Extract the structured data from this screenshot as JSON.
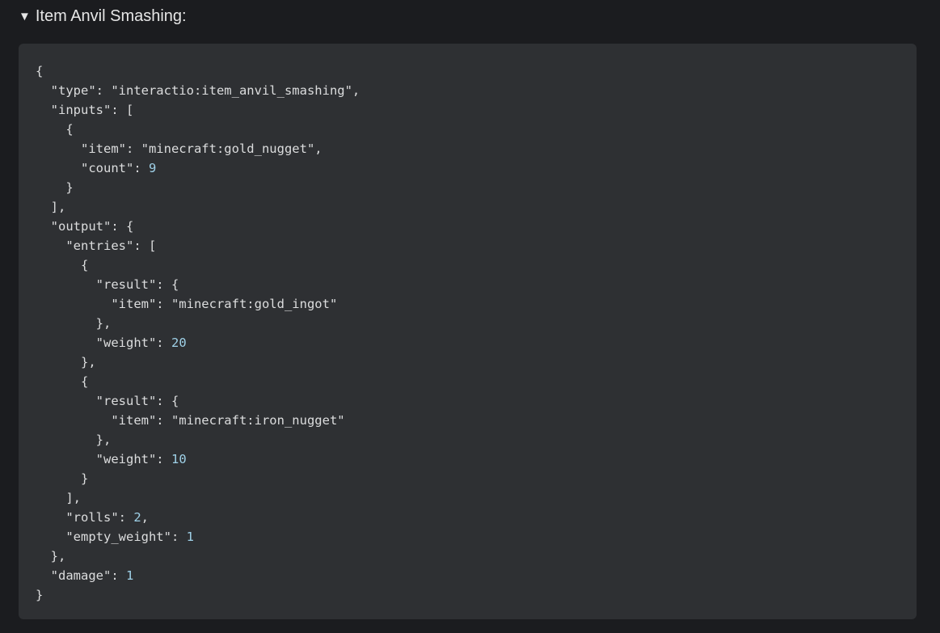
{
  "summary": {
    "triangle": "▼",
    "title": "Item Anvil Smashing:"
  },
  "code": {
    "lines": [
      "{",
      "  \"type\": \"interactio:item_anvil_smashing\",",
      "  \"inputs\": [",
      "    {",
      "      \"item\": \"minecraft:gold_nugget\",",
      "      \"count\": 9",
      "    }",
      "  ],",
      "  \"output\": {",
      "    \"entries\": [",
      "      {",
      "        \"result\": {",
      "          \"item\": \"minecraft:gold_ingot\"",
      "        },",
      "        \"weight\": 20",
      "      },",
      "      {",
      "        \"result\": {",
      "          \"item\": \"minecraft:iron_nugget\"",
      "        },",
      "        \"weight\": 10",
      "      }",
      "    ],",
      "    \"rolls\": 2,",
      "    \"empty_weight\": 1",
      "  },",
      "  \"damage\": 1",
      "}"
    ],
    "number_color": "#9fd1e8",
    "background": "#2e3033"
  }
}
